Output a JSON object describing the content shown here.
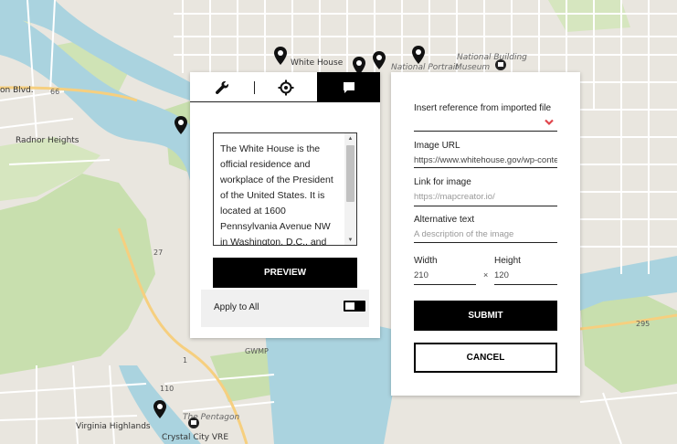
{
  "map": {
    "labels": {
      "white_house": "White House",
      "national_building": "National Building",
      "museum": "Museum",
      "national_portrait": "National Portrait",
      "on_blvd": "on Blvd.",
      "radnor_heights": "Radnor Heights",
      "virginia_highlands": "Virginia Highlands",
      "crystal_city_vre": "Crystal City VRE",
      "the_pentagon": "The Pentagon",
      "gwmp": "GWMP",
      "route_110": "110",
      "route_27": "27",
      "route_1": "1",
      "route_66": "66",
      "route_29": "295"
    },
    "colors": {
      "water": "#aad3df",
      "park": "#c8dfae",
      "land": "#e9e6df",
      "road": "#ffffff",
      "pin": "#111111"
    }
  },
  "left_panel": {
    "tabs": {
      "tools_icon": "wrench-icon",
      "target_icon": "crosshair-icon",
      "comment_icon": "comment-icon",
      "active": "comment"
    },
    "description_text": "The White House is the official residence and workplace of the President of the United States. It is located at 1600 Pennsylvania Avenue NW in Washington, D.C., and has",
    "preview_label": "PREVIEW",
    "apply_to_all_label": "Apply to All",
    "apply_to_all_on": true
  },
  "right_panel": {
    "insert_reference_label": "Insert reference from imported file",
    "image_url_label": "Image URL",
    "image_url_value": "https://www.whitehouse.gov/wp-conte",
    "link_label": "Link for image",
    "link_placeholder": "https://mapcreator.io/",
    "alt_label": "Alternative text",
    "alt_placeholder": "A description of the image",
    "width_label": "Width",
    "width_value": "210",
    "times_sign": "×",
    "height_label": "Height",
    "height_value": "120",
    "submit_label": "SUBMIT",
    "cancel_label": "CANCEL",
    "accent_color": "#e0454b"
  }
}
